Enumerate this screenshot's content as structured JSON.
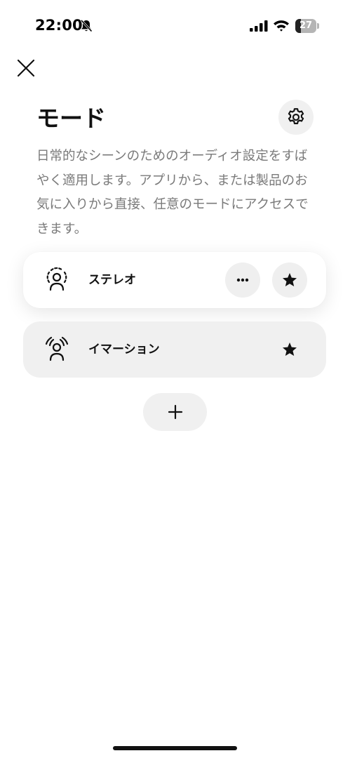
{
  "status_bar": {
    "time": "22:00",
    "battery_level": "27",
    "battery_fraction": 0.27
  },
  "header": {
    "title": "モード",
    "description": "日常的なシーンのためのオーディオ設定をすばやく適用します。アプリから、または製品のお気に入りから直接、任意のモードにアクセスできます。"
  },
  "modes": [
    {
      "label": "ステレオ",
      "icon": "stereo-person-icon",
      "selected": true,
      "favorite": true
    },
    {
      "label": "イマーション",
      "icon": "immersion-person-icon",
      "selected": false,
      "favorite": true
    }
  ],
  "icons": {
    "close": "close-icon",
    "settings": "gear-icon",
    "more": "more-dots-icon",
    "favorite": "star-icon",
    "add": "plus-icon"
  },
  "colors": {
    "card_selected": "#ffffff",
    "card_default": "#f0f0f0",
    "text_primary": "#111111",
    "text_secondary": "#7a7a7a"
  }
}
